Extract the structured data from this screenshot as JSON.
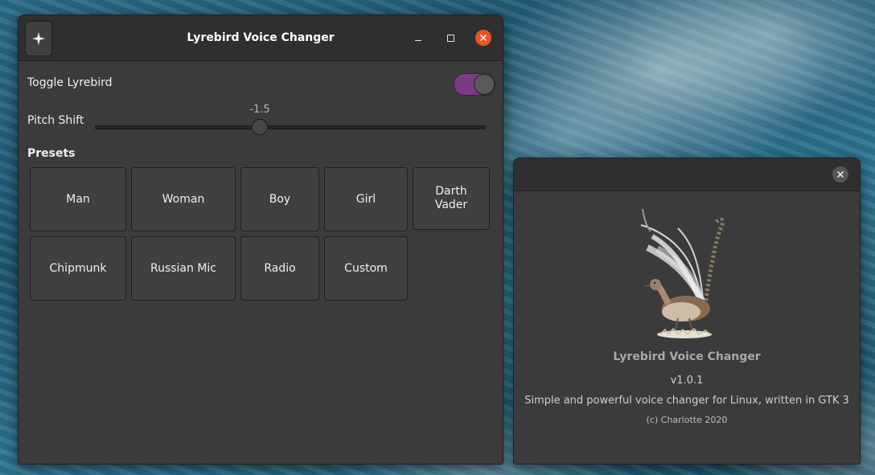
{
  "main_window": {
    "title": "Lyrebird Voice Changer",
    "toggle_label": "Toggle Lyrebird",
    "toggle_on": true,
    "pitch_label": "Pitch Shift",
    "pitch_value": "-1.5",
    "presets_heading": "Presets",
    "presets": [
      "Man",
      "Woman",
      "Boy",
      "Girl",
      "Darth Vader",
      "Chipmunk",
      "Russian Mic",
      "Radio",
      "Custom"
    ]
  },
  "about_window": {
    "app_name": "Lyrebird Voice Changer",
    "version": "v1.0.1",
    "description": "Simple and powerful voice changer for Linux, written in GTK 3",
    "copyright": "(c) Charlotte 2020"
  },
  "colors": {
    "accent_switch": "#7b3a84",
    "close_button": "#e95420",
    "window_bg": "#3b3b3b",
    "titlebar_bg": "#2f2f2f"
  }
}
